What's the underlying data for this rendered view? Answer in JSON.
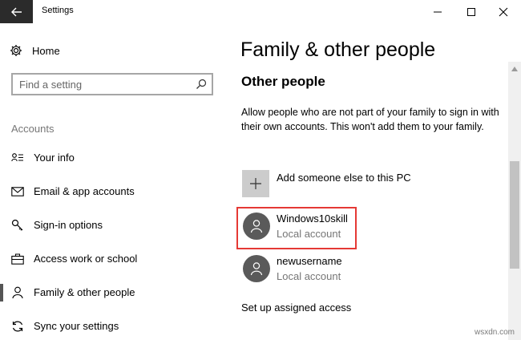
{
  "window": {
    "title": "Settings"
  },
  "sidebar": {
    "home_label": "Home",
    "search_placeholder": "Find a setting",
    "section_label": "Accounts",
    "items": [
      {
        "label": "Your info",
        "icon": "your-info-icon"
      },
      {
        "label": "Email & app accounts",
        "icon": "mail-icon"
      },
      {
        "label": "Sign-in options",
        "icon": "key-icon"
      },
      {
        "label": "Access work or school",
        "icon": "briefcase-icon"
      },
      {
        "label": "Family & other people",
        "icon": "person-icon",
        "active": true
      },
      {
        "label": "Sync your settings",
        "icon": "sync-icon"
      }
    ]
  },
  "main": {
    "title": "Family & other people",
    "subtitle": "Other people",
    "description": "Allow people who are not part of your family to sign in with their own accounts. This won't add them to your family.",
    "add_label": "Add someone else to this PC",
    "accounts": [
      {
        "name": "Windows10skill",
        "type": "Local account",
        "highlighted": true
      },
      {
        "name": "newusername",
        "type": "Local account"
      }
    ],
    "assigned_access": "Set up assigned access"
  },
  "watermark": "wsxdn.com",
  "colors": {
    "back_button": "#2b2b2b",
    "highlight": "#e53935",
    "avatar": "#5a5a5a"
  }
}
